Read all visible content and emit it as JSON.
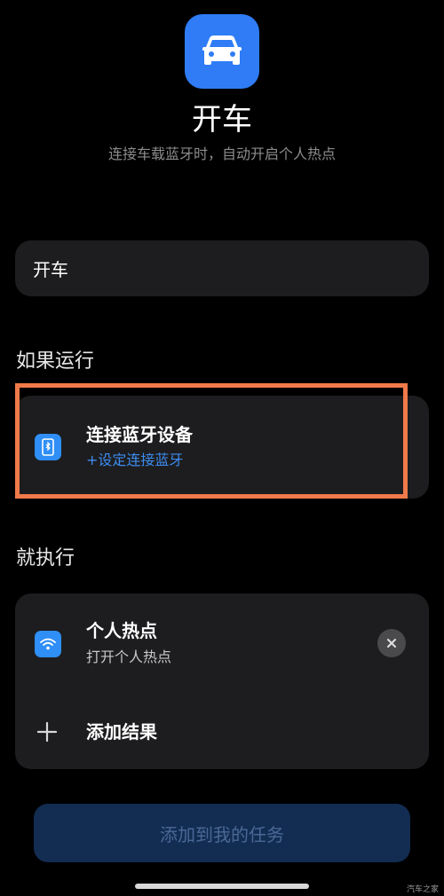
{
  "header": {
    "app_icon": "car-icon",
    "title": "开车",
    "subtitle": "连接车载蓝牙时，自动开启个人热点"
  },
  "name_field": {
    "value": "开车"
  },
  "trigger_section": {
    "label": "如果运行",
    "item": {
      "icon": "bluetooth-device-icon",
      "title": "连接蓝牙设备",
      "action_link": "+设定连接蓝牙"
    }
  },
  "action_section": {
    "label": "就执行",
    "item": {
      "icon": "wifi-hotspot-icon",
      "title": "个人热点",
      "subtitle": "打开个人热点"
    },
    "add_result_label": "添加结果"
  },
  "footer": {
    "add_button_label": "添加到我的任务"
  },
  "watermark": "汽车之家",
  "colors": {
    "accent": "#2f7cf6",
    "highlight": "#f07a4a",
    "link": "#3d8cf0",
    "card": "#1d1d1f",
    "background": "#000000"
  }
}
